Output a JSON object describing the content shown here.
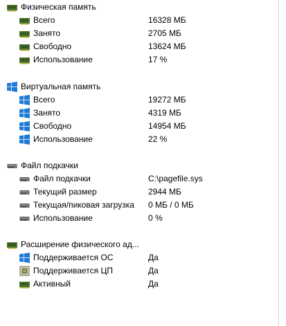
{
  "sections": [
    {
      "title": "Физическая память",
      "icon": "memory-module-icon",
      "items": [
        {
          "icon": "memory-module-icon",
          "label": "Всего",
          "value": "16328 МБ"
        },
        {
          "icon": "memory-module-icon",
          "label": "Занято",
          "value": "2705 МБ"
        },
        {
          "icon": "memory-module-icon",
          "label": "Свободно",
          "value": "13624 МБ"
        },
        {
          "icon": "memory-module-icon",
          "label": "Использование",
          "value": "17 %"
        }
      ]
    },
    {
      "title": "Виртуальная память",
      "icon": "windows-logo-icon",
      "items": [
        {
          "icon": "windows-logo-icon",
          "label": "Всего",
          "value": "19272 МБ"
        },
        {
          "icon": "windows-logo-icon",
          "label": "Занято",
          "value": "4319 МБ"
        },
        {
          "icon": "windows-logo-icon",
          "label": "Свободно",
          "value": "14954 МБ"
        },
        {
          "icon": "windows-logo-icon",
          "label": "Использование",
          "value": "22 %"
        }
      ]
    },
    {
      "title": "Файл подкачки",
      "icon": "drive-icon",
      "items": [
        {
          "icon": "drive-icon",
          "label": "Файл подкачки",
          "value": "C:\\pagefile.sys"
        },
        {
          "icon": "drive-icon",
          "label": "Текущий размер",
          "value": "2944 МБ"
        },
        {
          "icon": "drive-icon",
          "label": "Текущая/пиковая загрузка",
          "value": "0 МБ / 0 МБ"
        },
        {
          "icon": "drive-icon",
          "label": "Использование",
          "value": "0 %"
        }
      ]
    },
    {
      "title": "Расширение физического ад...",
      "icon": "memory-module-icon",
      "items": [
        {
          "icon": "windows-logo-icon",
          "label": "Поддерживается ОС",
          "value": "Да"
        },
        {
          "icon": "cpu-chip-icon",
          "label": "Поддерживается ЦП",
          "value": "Да"
        },
        {
          "icon": "memory-module-icon",
          "label": "Активный",
          "value": "Да"
        }
      ]
    }
  ],
  "colors": {
    "windows_blue": "#1e7ad6",
    "memory_green": "#4f7a32",
    "drive_gray": "#5a5a5a",
    "cpu_olive": "#7a7a3a",
    "divider": "#d6d6d6"
  }
}
